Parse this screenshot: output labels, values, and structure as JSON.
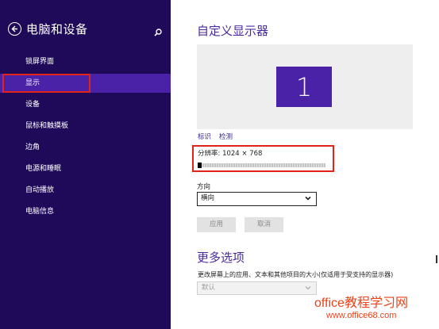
{
  "sidebar": {
    "title": "电脑和设备",
    "items": [
      {
        "label": "锁屏界面",
        "selected": false
      },
      {
        "label": "显示",
        "selected": true
      },
      {
        "label": "设备",
        "selected": false
      },
      {
        "label": "鼠标和触摸板",
        "selected": false
      },
      {
        "label": "边角",
        "selected": false
      },
      {
        "label": "电源和睡眠",
        "selected": false
      },
      {
        "label": "自动播放",
        "selected": false
      },
      {
        "label": "电脑信息",
        "selected": false
      }
    ]
  },
  "main": {
    "title": "自定义显示器",
    "monitor_number": "1",
    "identify_link": "标识",
    "detect_link": "检测",
    "resolution_label": "分辨率: 1024 × 768",
    "orientation_label": "方向",
    "orientation_value": "横向",
    "apply_button": "应用",
    "cancel_button": "取消",
    "more_options_title": "更多选项",
    "more_options_desc": "更改屏幕上的应用、文本和其他项目的大小(仅适用于受支持的显示器)",
    "size_value": "默认"
  },
  "watermark": {
    "line1": "office教程学习网",
    "line2": "www.office68.com"
  },
  "colors": {
    "sidebar_bg": "#1f0a5a",
    "selected_bg": "#4a22a8",
    "accent": "#4a2aa0",
    "highlight_border": "#e2231a",
    "watermark": "#e8431a"
  }
}
